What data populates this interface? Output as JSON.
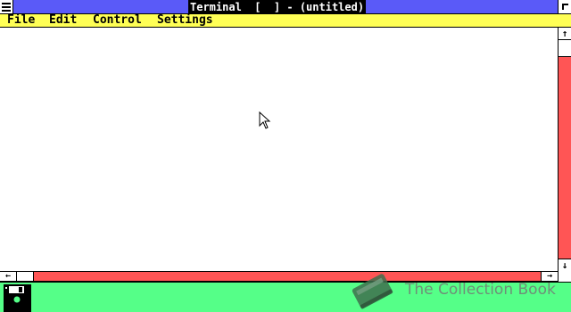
{
  "window": {
    "title": "Terminal  [  ] - (untitled)"
  },
  "menubar": {
    "items": [
      {
        "label": "File"
      },
      {
        "label": "Edit"
      },
      {
        "label": "Control"
      },
      {
        "label": "Settings"
      }
    ]
  },
  "scrollbars": {
    "up_arrow": "↑",
    "down_arrow": "↓",
    "left_arrow": "←",
    "right_arrow": "→"
  },
  "watermark": {
    "text": "The Collection Book"
  },
  "colors": {
    "titlebar": "#5a5af8",
    "menubar": "#ffff55",
    "scrollbar": "#ff5555",
    "icon_area": "#55ff88"
  },
  "icons": {
    "system_menu": "system-menu-icon",
    "size_box": "size-box-icon",
    "minimized_app": "terminal-disk-icon",
    "cursor": "mouse-pointer-icon",
    "watermark_logo": "book-icon"
  }
}
